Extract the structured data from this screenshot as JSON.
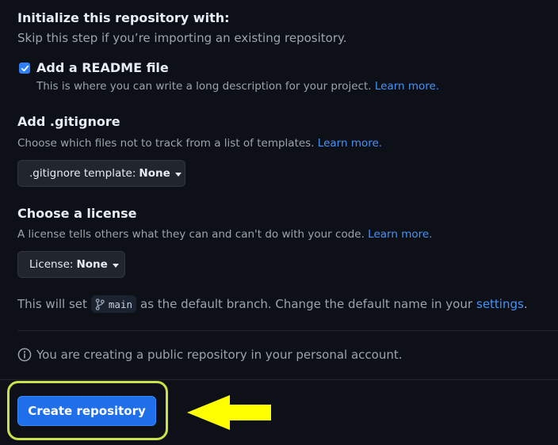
{
  "init_section": {
    "title": "Initialize this repository with:",
    "subtitle": "Skip this step if you’re importing an existing repository."
  },
  "readme": {
    "checked": true,
    "label": "Add a README file",
    "description": "This is where you can write a long description for your project.",
    "learn_more": "Learn more."
  },
  "gitignore": {
    "title": "Add .gitignore",
    "description": "Choose which files not to track from a list of templates.",
    "learn_more": "Learn more.",
    "dropdown_label": ".gitignore template:",
    "dropdown_value": "None"
  },
  "license": {
    "title": "Choose a license",
    "description": "A license tells others what they can and can't do with your code.",
    "learn_more": "Learn more.",
    "dropdown_label": "License:",
    "dropdown_value": "None"
  },
  "branch": {
    "prefix": "This will set",
    "name": "main",
    "suffix": "as the default branch. Change the default name in your",
    "settings_link": "settings",
    "end": "."
  },
  "visibility_notice": "You are creating a public repository in your personal account.",
  "create_button": "Create repository",
  "colors": {
    "background": "#0d1117",
    "link": "#4493f8",
    "primary_button": "#1f6feb",
    "highlight_outline": "#c6e34a",
    "arrow": "#ffff00"
  }
}
